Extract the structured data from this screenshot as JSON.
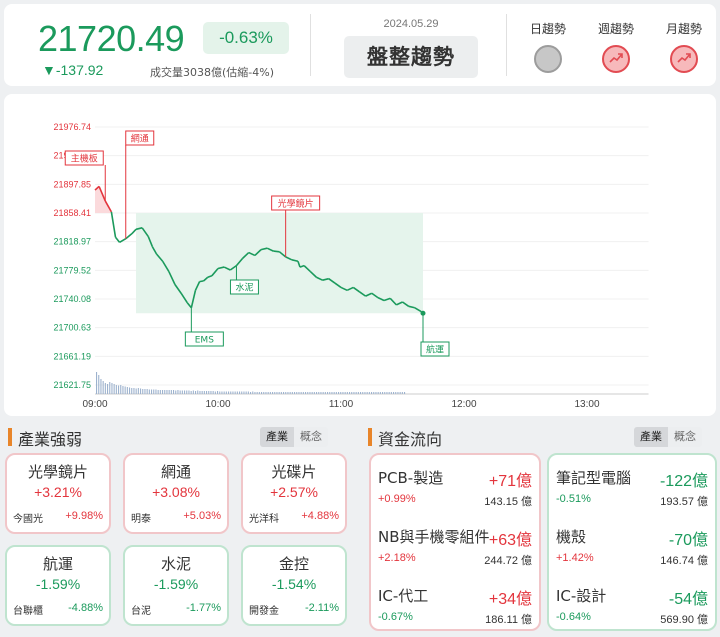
{
  "header": {
    "index_value": "21720.49",
    "change_percent": "-0.63%",
    "change_points": "▼-137.92",
    "volume_text": "成交量3038億(估縮-4%)",
    "date": "2024.05.29",
    "trend_label": "盤整趨勢",
    "trends": [
      {
        "label": "日趨勢",
        "state": "neutral"
      },
      {
        "label": "週趨勢",
        "state": "up"
      },
      {
        "label": "月趨勢",
        "state": "up"
      }
    ]
  },
  "colors": {
    "up": "#e3353d",
    "down": "#1b9a5c",
    "accent": "#e8852a"
  },
  "chart_data": {
    "type": "line",
    "y_ticks": [
      "21976.74",
      "21937.30",
      "21897.85",
      "21858.41",
      "21818.97",
      "21779.52",
      "21740.08",
      "21700.63",
      "21661.19",
      "21621.75"
    ],
    "x_ticks": [
      "09:00",
      "10:00",
      "11:00",
      "12:00",
      "13:00"
    ],
    "reference": 21858.41,
    "ylim": [
      21621.75,
      21976.74
    ],
    "x_range": [
      "09:00",
      "13:30"
    ],
    "series": [
      {
        "time": [
          "09:00",
          "09:02",
          "09:05",
          "09:08",
          "09:10",
          "09:12",
          "09:15",
          "09:18",
          "09:20",
          "09:23",
          "09:26",
          "09:28",
          "09:30",
          "09:33",
          "09:36",
          "09:39",
          "09:42",
          "09:45",
          "09:47",
          "09:49",
          "09:51",
          "09:53",
          "09:55",
          "09:57",
          "10:00",
          "10:03",
          "10:06",
          "10:09",
          "10:12",
          "10:15",
          "10:18",
          "10:21",
          "10:24",
          "10:27",
          "10:30",
          "10:33",
          "10:36",
          "10:39",
          "10:40",
          "10:42",
          "10:45",
          "10:48",
          "10:51",
          "10:54",
          "10:57",
          "11:00",
          "11:03",
          "11:06",
          "11:09",
          "11:12",
          "11:15",
          "11:18",
          "11:21",
          "11:24",
          "11:27",
          "11:30",
          "11:33",
          "11:36",
          "11:39",
          "11:40"
        ],
        "values": [
          21890,
          21895,
          21875,
          21860,
          21825,
          21818,
          21823,
          21830,
          21836,
          21838,
          21826,
          21812,
          21802,
          21792,
          21778,
          21760,
          21748,
          21735,
          21728,
          21752,
          21764,
          21765,
          21770,
          21772,
          21782,
          21784,
          21780,
          21786,
          21796,
          21804,
          21800,
          21808,
          21810,
          21806,
          21805,
          21798,
          21794,
          21792,
          21784,
          21786,
          21778,
          21770,
          21766,
          21768,
          21762,
          21756,
          21752,
          21756,
          21750,
          21744,
          21748,
          21742,
          21738,
          21741,
          21732,
          21736,
          21730,
          21728,
          21723,
          21720.49
        ]
      }
    ],
    "annotations": [
      {
        "label": "主機板",
        "time": "09:05",
        "value": 21875,
        "kind": "up"
      },
      {
        "label": "網通",
        "time": "09:15",
        "value": 21823,
        "kind": "up"
      },
      {
        "label": "光學鏡片",
        "time": "10:33",
        "value": 21798,
        "kind": "up"
      },
      {
        "label": "EMS",
        "time": "09:47",
        "value": 21728,
        "kind": "down"
      },
      {
        "label": "水泥",
        "time": "10:09",
        "value": 21786,
        "kind": "down"
      },
      {
        "label": "航運",
        "time": "11:40",
        "value": 21720.49,
        "kind": "down"
      }
    ],
    "volume": [
      44,
      38,
      30,
      26,
      22,
      20,
      24,
      22,
      20,
      18,
      17,
      18,
      16,
      15,
      14,
      13,
      12,
      12,
      11,
      12,
      11,
      10,
      10,
      10,
      9,
      9,
      9,
      9,
      8,
      8,
      8,
      8,
      8,
      8,
      8,
      8,
      7,
      8,
      7,
      7,
      7,
      7,
      7,
      6,
      7,
      6,
      7,
      6,
      6,
      6,
      6,
      6,
      6,
      6,
      5,
      6,
      5,
      5,
      5,
      5,
      5,
      5,
      5,
      5,
      5,
      5,
      5,
      5,
      5,
      5,
      4,
      5,
      4,
      4,
      4,
      4,
      4,
      4,
      4,
      4,
      4,
      4,
      4,
      4,
      4,
      4,
      4,
      4,
      4,
      4,
      4,
      4,
      4,
      4,
      4,
      4,
      4,
      4,
      4,
      4,
      4,
      4,
      4,
      4,
      4,
      4,
      4,
      4,
      4,
      4,
      4,
      4,
      4,
      4,
      4,
      4,
      4,
      4,
      4,
      4,
      4,
      4,
      4,
      4,
      4,
      4,
      4,
      4,
      4,
      4,
      4,
      4,
      4,
      4,
      4,
      4,
      4,
      4,
      4,
      4,
      4
    ]
  },
  "industry": {
    "title": "產業強弱",
    "tabs": [
      "產業",
      "概念"
    ],
    "cards": [
      {
        "name": "光學鏡片",
        "pct": "+3.21%",
        "stock": "今國光",
        "stock_pct": "+9.98%",
        "dir": "up"
      },
      {
        "name": "網通",
        "pct": "+3.08%",
        "stock": "明泰",
        "stock_pct": "+5.03%",
        "dir": "up"
      },
      {
        "name": "光碟片",
        "pct": "+2.57%",
        "stock": "光洋科",
        "stock_pct": "+4.88%",
        "dir": "up"
      },
      {
        "name": "航運",
        "pct": "-1.59%",
        "stock": "台聯櫃",
        "stock_pct": "-4.88%",
        "dir": "down"
      },
      {
        "name": "水泥",
        "pct": "-1.59%",
        "stock": "台泥",
        "stock_pct": "-1.77%",
        "dir": "down"
      },
      {
        "name": "金控",
        "pct": "-1.54%",
        "stock": "開發金",
        "stock_pct": "-2.11%",
        "dir": "down"
      }
    ]
  },
  "fund_flow": {
    "title": "資金流向",
    "tabs": [
      "產業",
      "概念"
    ],
    "inflow": [
      {
        "name": "PCB-製造",
        "amount": "+71億",
        "pct": "+0.99%",
        "value": "143.15 億"
      },
      {
        "name": "NB與手機零組件",
        "amount": "+63億",
        "pct": "+2.18%",
        "value": "244.72 億"
      },
      {
        "name": "IC-代工",
        "amount": "+34億",
        "pct": "-0.67%",
        "value": "186.11 億"
      }
    ],
    "outflow": [
      {
        "name": "筆記型電腦",
        "amount": "-122億",
        "pct": "-0.51%",
        "value": "193.57 億"
      },
      {
        "name": "機殼",
        "amount": "-70億",
        "pct": "+1.42%",
        "value": "146.74 億"
      },
      {
        "name": "IC-設計",
        "amount": "-54億",
        "pct": "-0.64%",
        "value": "569.90 億"
      }
    ]
  }
}
